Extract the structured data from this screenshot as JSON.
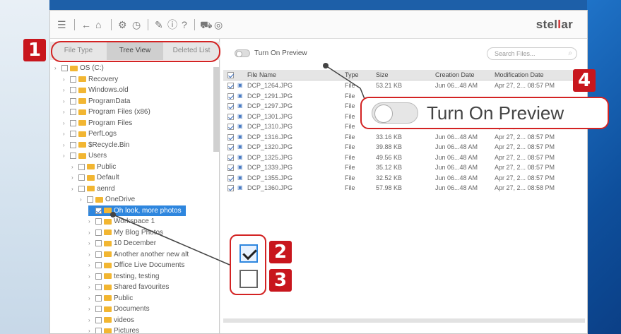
{
  "toolbar": {
    "logo_prefix": "stel",
    "logo_accent": "l",
    "logo_suffix": "ar"
  },
  "tabs": [
    {
      "label": "File Type"
    },
    {
      "label": "Tree View",
      "active": true
    },
    {
      "label": "Deleted List"
    }
  ],
  "tree": [
    {
      "label": "OS (C:)",
      "checked": false
    },
    {
      "label": "Recovery"
    },
    {
      "label": "Windows.old"
    },
    {
      "label": "ProgramData"
    },
    {
      "label": "Program Files (x86)"
    },
    {
      "label": "Program Files"
    },
    {
      "label": "PerfLogs"
    },
    {
      "label": "$Recycle.Bin"
    },
    {
      "label": "Users"
    },
    {
      "label": "Public"
    },
    {
      "label": "Default"
    },
    {
      "label": "aenrd"
    },
    {
      "label": "OneDrive"
    },
    {
      "label": "Oh look, more photos",
      "selected": true,
      "checked": true
    },
    {
      "label": "Workspace 1"
    },
    {
      "label": "My Blog Photos"
    },
    {
      "label": "10 December"
    },
    {
      "label": "Another another new alt"
    },
    {
      "label": "Office Live Documents"
    },
    {
      "label": "testing, testing"
    },
    {
      "label": "Shared favourites"
    },
    {
      "label": "Public"
    },
    {
      "label": "Documents"
    },
    {
      "label": "videos"
    },
    {
      "label": "Pictures"
    }
  ],
  "preview": {
    "label": "Turn On Preview"
  },
  "search": {
    "placeholder": "Search Files..."
  },
  "table": {
    "columns": [
      "File Name",
      "Type",
      "Size",
      "Creation Date",
      "Modification Date"
    ],
    "rows": [
      {
        "name": "DCP_1264.JPG",
        "type": "File",
        "size": "53.21 KB",
        "created": "Jun 06...48 AM",
        "modified": "Apr 27, 2... 08:57 PM"
      },
      {
        "name": "DCP_1291.JPG",
        "type": "File",
        "size": "",
        "created": "",
        "modified": ""
      },
      {
        "name": "DCP_1297.JPG",
        "type": "File",
        "size": "",
        "created": "",
        "modified": ""
      },
      {
        "name": "DCP_1301.JPG",
        "type": "File",
        "size": "",
        "created": "",
        "modified": ""
      },
      {
        "name": "DCP_1310.JPG",
        "type": "File",
        "size": "25.19 KB",
        "created": "Jun 06...48 AM",
        "modified": "Apr 27, 2... 08:57 PM"
      },
      {
        "name": "DCP_1316.JPG",
        "type": "File",
        "size": "33.16 KB",
        "created": "Jun 06...48 AM",
        "modified": "Apr 27, 2... 08:57 PM"
      },
      {
        "name": "DCP_1320.JPG",
        "type": "File",
        "size": "39.88 KB",
        "created": "Jun 06...48 AM",
        "modified": "Apr 27, 2... 08:57 PM"
      },
      {
        "name": "DCP_1325.JPG",
        "type": "File",
        "size": "49.56 KB",
        "created": "Jun 06...48 AM",
        "modified": "Apr 27, 2... 08:57 PM"
      },
      {
        "name": "DCP_1339.JPG",
        "type": "File",
        "size": "35.12 KB",
        "created": "Jun 06...48 AM",
        "modified": "Apr 27, 2... 08:57 PM"
      },
      {
        "name": "DCP_1355.JPG",
        "type": "File",
        "size": "32.52 KB",
        "created": "Jun 06...48 AM",
        "modified": "Apr 27, 2... 08:57 PM"
      },
      {
        "name": "DCP_1360.JPG",
        "type": "File",
        "size": "57.98 KB",
        "created": "Jun 06...48 AM",
        "modified": "Apr 27, 2... 08:58 PM"
      }
    ]
  },
  "callouts": {
    "badges": [
      "1",
      "2",
      "3",
      "4"
    ],
    "preview_label": "Turn On Preview"
  },
  "colors": {
    "accent": "#c8161d",
    "selection": "#2e86de",
    "folder": "#f2b632"
  },
  "icons": [
    "menu-icon",
    "back-icon",
    "home-icon",
    "scan-icon",
    "recover-icon",
    "wand-icon",
    "info-icon",
    "help-icon",
    "cart-icon",
    "user-icon"
  ]
}
